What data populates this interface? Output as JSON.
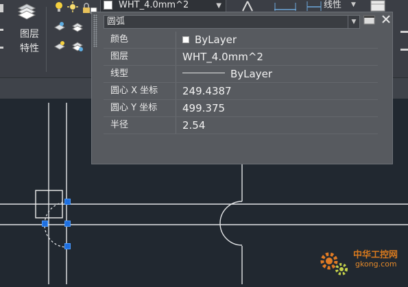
{
  "ribbon": {
    "layer_group_label_line1": "图层",
    "layer_group_label_line2": "特性",
    "layer_combo_value": "WHT_4.0mm^2",
    "linetype_label": "线性"
  },
  "properties_panel": {
    "selection_type": "圆弧",
    "rows": [
      {
        "key": "颜色",
        "value": "ByLayer",
        "kind": "color"
      },
      {
        "key": "图层",
        "value": "WHT_4.0mm^2",
        "kind": "text"
      },
      {
        "key": "线型",
        "value": "ByLayer",
        "kind": "linetype"
      },
      {
        "key": "圆心 X 坐标",
        "value": "249.4387",
        "kind": "text"
      },
      {
        "key": "圆心 Y 坐标",
        "value": "499.375",
        "kind": "text"
      },
      {
        "key": "半径",
        "value": "2.54",
        "kind": "text"
      }
    ]
  },
  "watermark": {
    "line1": "中华工控网",
    "line2": "gkong.com"
  },
  "colors": {
    "canvas": "#212830",
    "grip": "#1e6fe0",
    "panel": "#575a5f"
  }
}
